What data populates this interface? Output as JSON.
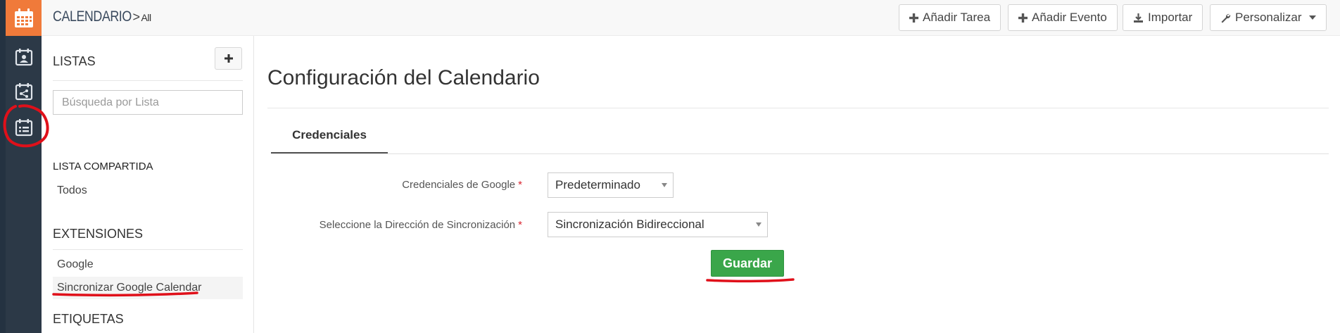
{
  "header": {
    "app_name": "CALENDARIO",
    "crumb_separator": ">",
    "crumb_current": "All",
    "buttons": {
      "add_task": "Añadir Tarea",
      "add_event": "Añadir Evento",
      "import": "Importar",
      "customize": "Personalizar"
    }
  },
  "sidebar": {
    "lists_title": "LISTAS",
    "search_placeholder": "Búsqueda por Lista",
    "shared_title": "LISTA COMPARTIDA",
    "shared_items": [
      "Todos"
    ],
    "extensions_title": "EXTENSIONES",
    "extension_items": [
      "Google",
      "Sincronizar Google Calendar"
    ],
    "tags_title": "ETIQUETAS"
  },
  "main": {
    "title": "Configuración del Calendario",
    "tabs": [
      {
        "label": "Credenciales",
        "active": true
      }
    ],
    "form": {
      "credentials_label": "Credenciales de Google",
      "credentials_value": "Predeterminado",
      "sync_label": "Seleccione la Dirección de Sincronización",
      "sync_value": "Sincronización Bidireccional",
      "required_mark": "*",
      "save_label": "Guardar"
    }
  },
  "colors": {
    "rail_bg": "#2c3947",
    "brand_orange": "#f07a3a",
    "save_green": "#3aa64a",
    "annotation_red": "#e0101a",
    "required_red": "#d9232e"
  },
  "icons": {
    "rail": [
      "calendar-grid-icon",
      "calendar-contact-icon",
      "calendar-share-icon",
      "calendar-list-icon"
    ],
    "add_list": "plus-icon",
    "add_task": "plus-icon",
    "add_event": "plus-icon",
    "import": "download-icon",
    "customize": "wrench-icon"
  }
}
